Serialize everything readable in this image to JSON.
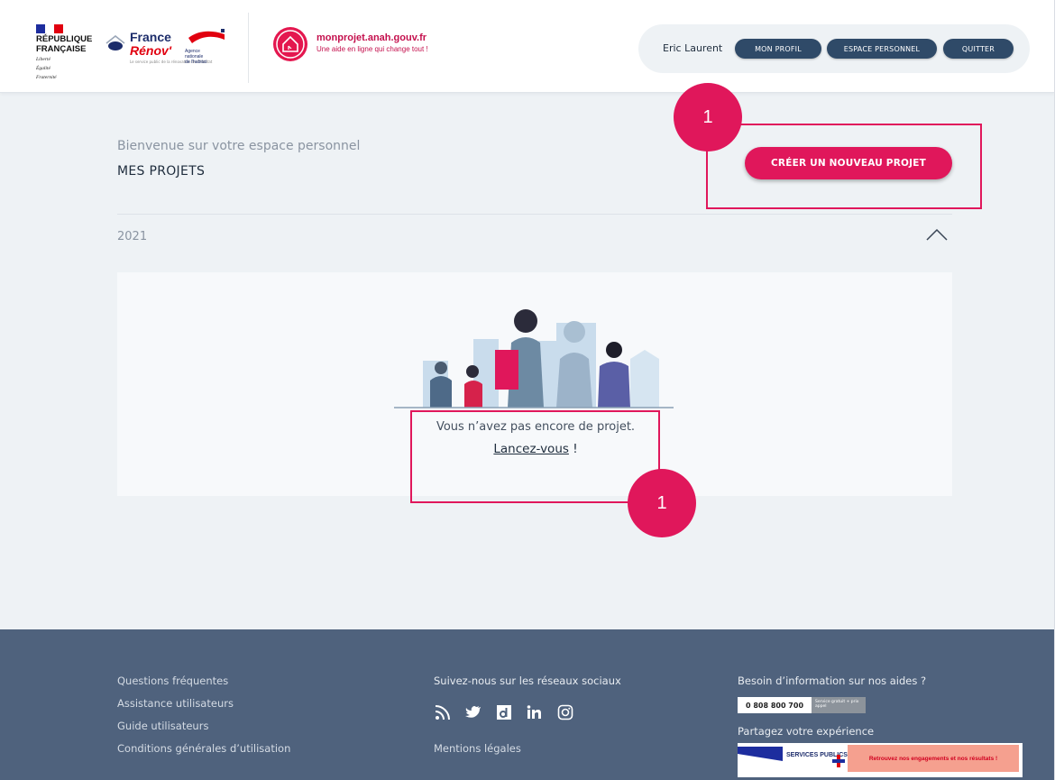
{
  "header": {
    "republique": {
      "line1": "RÉPUBLIQUE",
      "line2": "FRANÇAISE",
      "motto": [
        "Liberté",
        "Égalité",
        "Fraternité"
      ]
    },
    "france_renov": {
      "line1": "France",
      "line2": "Rénov'",
      "tagline": "Le service public de la rénovation de l'habitat"
    },
    "anah": {
      "lines": [
        "Agence",
        "nationale",
        "de l'habitat"
      ]
    },
    "monprojet": {
      "site": "monprojet.anah.gouv.fr",
      "tagline": "Une aide en ligne qui change tout !"
    },
    "user": {
      "name": "Eric Laurent",
      "buttons": {
        "profile": "MON PROFIL",
        "space": "ESPACE PERSONNEL",
        "quit": "QUITTER"
      }
    }
  },
  "main": {
    "welcome": "Bienvenue sur votre espace personnel",
    "section_title": "MES PROJETS",
    "create_button": "CRÉER UN NOUVEAU PROJET",
    "year": "2021",
    "empty_text": "Vous n’avez pas encore de projet.",
    "launch_link": "Lancez-vous",
    "launch_suffix": " !"
  },
  "annotations": {
    "badge_top": "1",
    "badge_bottom": "1",
    "color": "#e0175b"
  },
  "footer": {
    "links": [
      "Questions fréquentes",
      "Assistance utilisateurs",
      "Guide utilisateurs",
      "Conditions générales d’utilisation"
    ],
    "social_title": "Suivez-nous sur les réseaux sociaux",
    "social_icons": [
      "rss-icon",
      "twitter-icon",
      "dailymotion-icon",
      "linkedin-icon",
      "instagram-icon"
    ],
    "legal": "Mentions légales",
    "info_title": "Besoin d’information sur nos aides ?",
    "phone": "0 808 800 700",
    "phone_note": "Service gratuit + prix appel",
    "share_title": "Partagez votre expérience",
    "services_publics": "SERVICES PUBLICS+",
    "services_banner": "Retrouvez nos engagements et nos résultats !"
  },
  "colors": {
    "brand_pink": "#e0175b",
    "navy_button": "#2f4a68",
    "footer_bg": "#4f627d",
    "page_bg": "#eef2f5"
  }
}
